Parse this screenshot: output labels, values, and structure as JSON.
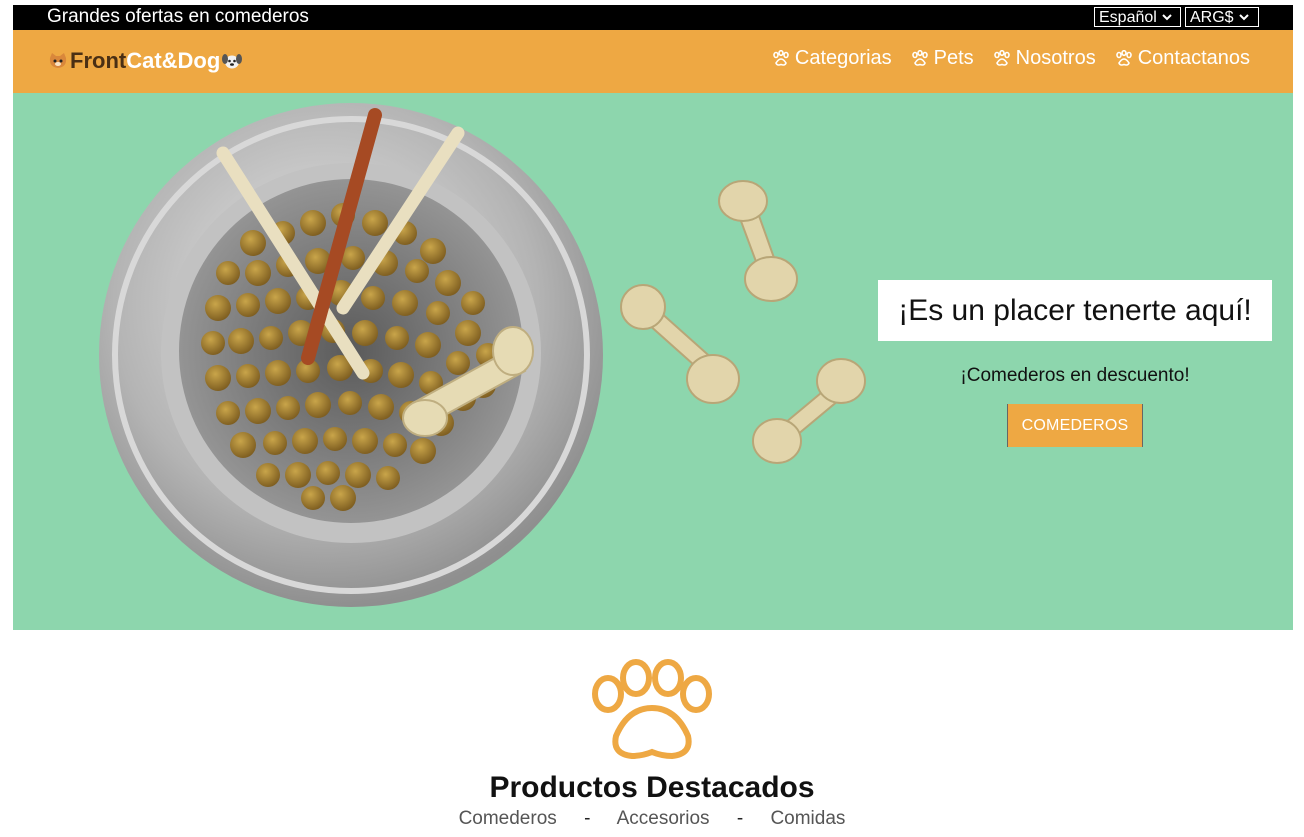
{
  "topbar": {
    "promo": "Grandes ofertas en comederos",
    "language": "Español",
    "currency": "ARG$"
  },
  "nav": {
    "logo_front": "Front",
    "logo_brand": "Cat&Dog",
    "items": [
      "Categorias",
      "Pets",
      "Nosotros",
      "Contactanos"
    ]
  },
  "hero": {
    "title": "¡Es un placer tenerte aquí!",
    "subtitle": "¡Comederos en descuento!",
    "button": "COMEDEROS"
  },
  "featured": {
    "title": "Productos Destacados",
    "categories": [
      "Comederos",
      "Accesorios",
      "Comidas"
    ],
    "separator": "-"
  },
  "colors": {
    "accent": "#eea843",
    "hero_bg": "#8dd6ad",
    "topbar": "#000000"
  }
}
